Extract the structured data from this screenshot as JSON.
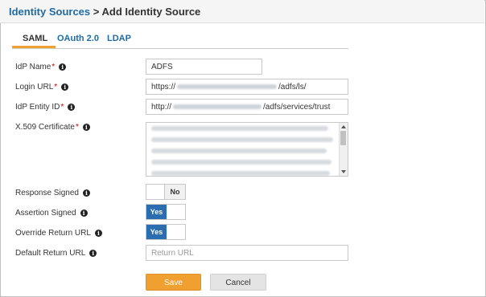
{
  "header": {
    "breadcrumb_link": "Identity Sources",
    "separator": ">",
    "title": "Add Identity Source"
  },
  "tabs": [
    {
      "label": "SAML",
      "active": true
    },
    {
      "label": "OAuth 2.0",
      "active": false
    },
    {
      "label": "LDAP",
      "active": false
    }
  ],
  "form": {
    "idp_name": {
      "label": "IdP Name",
      "required_mark": "*",
      "value": "ADFS"
    },
    "login_url": {
      "label": "Login URL",
      "required_mark": "*",
      "prefix": "https://",
      "suffix": "/adfs/ls/"
    },
    "idp_entity_id": {
      "label": "IdP Entity ID",
      "required_mark": "*",
      "prefix": "http://",
      "suffix": "/adfs/services/trust"
    },
    "x509_certificate": {
      "label": "X.509 Certificate",
      "required_mark": "*"
    },
    "response_signed": {
      "label": "Response Signed",
      "state": "No"
    },
    "assertion_signed": {
      "label": "Assertion Signed",
      "state": "Yes"
    },
    "override_return_url": {
      "label": "Override Return URL",
      "state": "Yes"
    },
    "default_return_url": {
      "label": "Default Return URL",
      "placeholder": "Return URL"
    }
  },
  "info_icon": "info-circle-icon",
  "buttons": {
    "save": "Save",
    "cancel": "Cancel"
  },
  "colors": {
    "link": "#1f6aa5",
    "accent": "#f0a030",
    "toggle_on": "#2a6db0",
    "required": "#cc0000"
  }
}
